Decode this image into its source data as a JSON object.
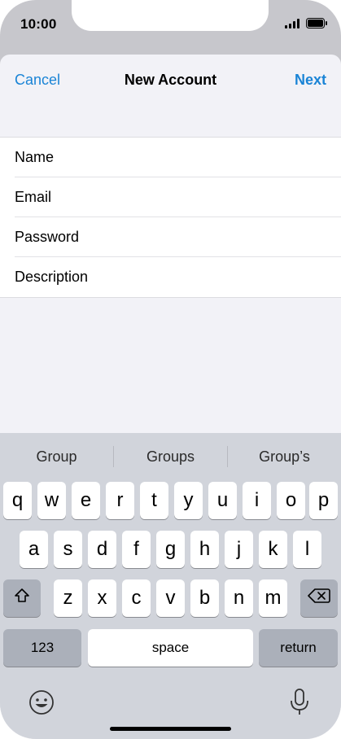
{
  "status_bar": {
    "time": "10:00"
  },
  "nav": {
    "cancel": "Cancel",
    "title": "New Account",
    "next": "Next"
  },
  "form": {
    "fields": [
      {
        "placeholder": "Name"
      },
      {
        "placeholder": "Email"
      },
      {
        "placeholder": "Password"
      },
      {
        "placeholder": "Description"
      }
    ]
  },
  "keyboard": {
    "suggestions": [
      "Group",
      "Groups",
      "Group’s"
    ],
    "row1": [
      "q",
      "w",
      "e",
      "r",
      "t",
      "y",
      "u",
      "i",
      "o",
      "p"
    ],
    "row2": [
      "a",
      "s",
      "d",
      "f",
      "g",
      "h",
      "j",
      "k",
      "l"
    ],
    "row3": [
      "z",
      "x",
      "c",
      "v",
      "b",
      "n",
      "m"
    ],
    "numbers_label": "123",
    "space_label": "space",
    "return_label": "return"
  },
  "icons": [
    "signal-icon",
    "battery-icon",
    "shift-icon",
    "backspace-icon",
    "emoji-icon",
    "microphone-icon"
  ]
}
